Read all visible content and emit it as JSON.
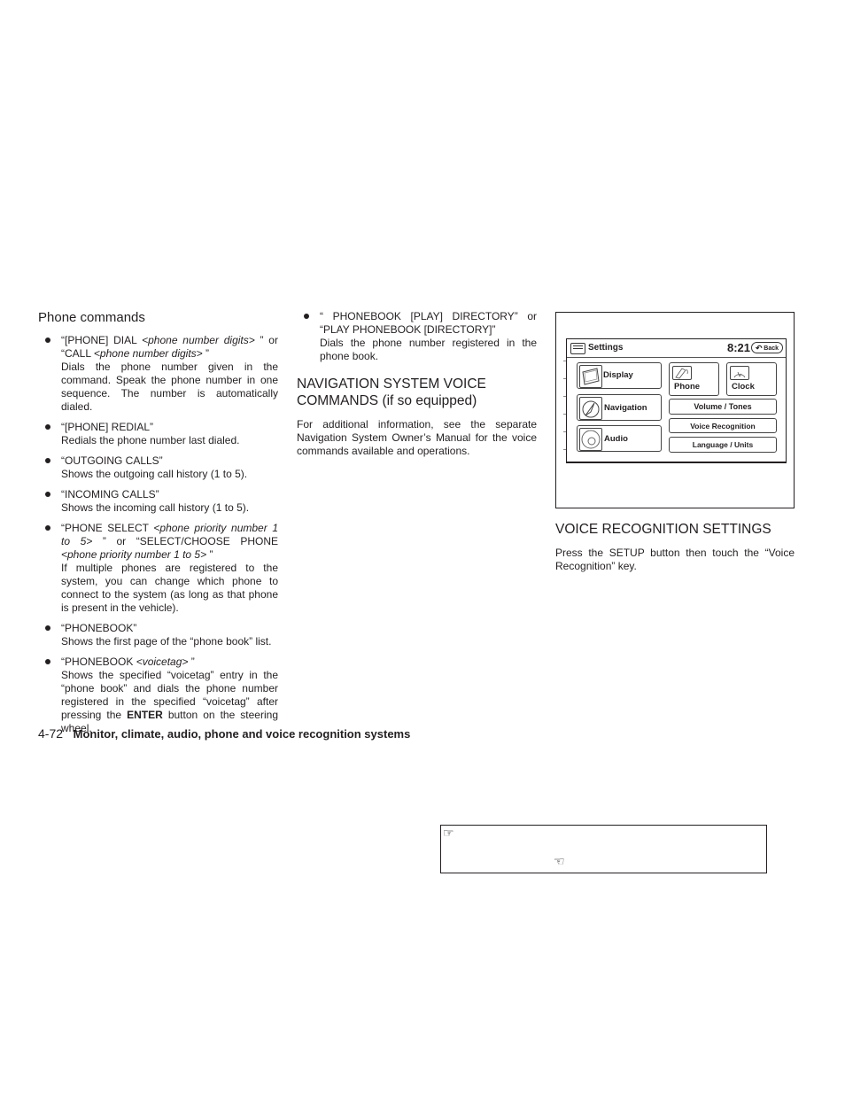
{
  "column1": {
    "heading": "Phone commands",
    "items": [
      {
        "command_parts": [
          {
            "text": "“[PHONE] DIAL ",
            "italic": false
          },
          {
            "text": "<phone number digits>",
            "italic": true
          },
          {
            "text": " ” or “CALL ",
            "italic": false
          },
          {
            "text": "<phone number digits>",
            "italic": true
          },
          {
            "text": " ”",
            "italic": false
          }
        ],
        "description": "Dials the phone number given in the command. Speak the phone number in one sequence. The number is automatically dialed."
      },
      {
        "command_parts": [
          {
            "text": "“[PHONE] REDIAL”",
            "italic": false
          }
        ],
        "description": "Redials the phone number last dialed."
      },
      {
        "command_parts": [
          {
            "text": "“OUTGOING CALLS”",
            "italic": false
          }
        ],
        "description": "Shows the outgoing call history (1 to 5)."
      },
      {
        "command_parts": [
          {
            "text": "“INCOMING CALLS”",
            "italic": false
          }
        ],
        "description": "Shows the incoming call history (1 to 5)."
      },
      {
        "command_parts": [
          {
            "text": "“PHONE SELECT ",
            "italic": false
          },
          {
            "text": "<phone priority number 1 to 5>",
            "italic": true
          },
          {
            "text": " ” or “SELECT/CHOOSE PHONE ",
            "italic": false
          },
          {
            "text": "<phone priority number 1 to 5>",
            "italic": true
          },
          {
            "text": " ”",
            "italic": false
          }
        ],
        "description": "If multiple phones are registered to the system, you can change which phone to connect to the system (as long as that phone is present in the vehicle)."
      },
      {
        "command_parts": [
          {
            "text": "“PHONEBOOK”",
            "italic": false
          }
        ],
        "description": "Shows the first page of the “phone book” list."
      },
      {
        "command_parts": [
          {
            "text": "“PHONEBOOK ",
            "italic": false
          },
          {
            "text": "<voicetag>",
            "italic": true
          },
          {
            "text": " ”",
            "italic": false
          }
        ],
        "description_parts": [
          {
            "text": "Shows the specified “voicetag” entry in the “phone book” and dials the phone number registered in the specified “voicetag” after pressing the ",
            "bold": false
          },
          {
            "text": "ENTER",
            "bold": true
          },
          {
            "text": " button on the steering wheel.",
            "bold": false
          }
        ]
      }
    ]
  },
  "column2": {
    "items": [
      {
        "command": "“ PHONEBOOK [PLAY] DIRECTORY” or “PLAY PHONEBOOK [DIRECTORY]”",
        "description": "Dials the phone number registered in the phone book."
      }
    ],
    "nav_heading_main": "NAVIGATION SYSTEM VOICE COMMANDS",
    "nav_heading_suffix": " (if so equipped)",
    "nav_body": "For additional information, see the separate Navigation System Owner’s Manual for the voice commands available and operations."
  },
  "figure": {
    "screen_title": "Settings",
    "time": "8:21",
    "back_label": "Back",
    "buttons": {
      "display": "Display",
      "navigation": "Navigation",
      "audio": "Audio",
      "phone": "Phone",
      "clock": "Clock",
      "volume": "Volume / Tones",
      "voice": "Voice Recognition",
      "language": "Language / Units"
    },
    "icons": {
      "menu": "menu-icon",
      "back": "back-arrow-icon",
      "display": "display-monitor-icon",
      "navigation": "navigation-compass-icon",
      "audio": "audio-disc-icon",
      "phone": "phone-handset-icon",
      "clock": "clock-icon"
    }
  },
  "column3": {
    "heading": "VOICE RECOGNITION SETTINGS",
    "body": "Press the SETUP button then touch the “Voice Recognition” key."
  },
  "footer": {
    "page_number": "4-72",
    "title": "Monitor, climate, audio, phone and voice recognition systems"
  },
  "reference_box": {
    "icon_1": "☞",
    "icon_2": "☜"
  }
}
